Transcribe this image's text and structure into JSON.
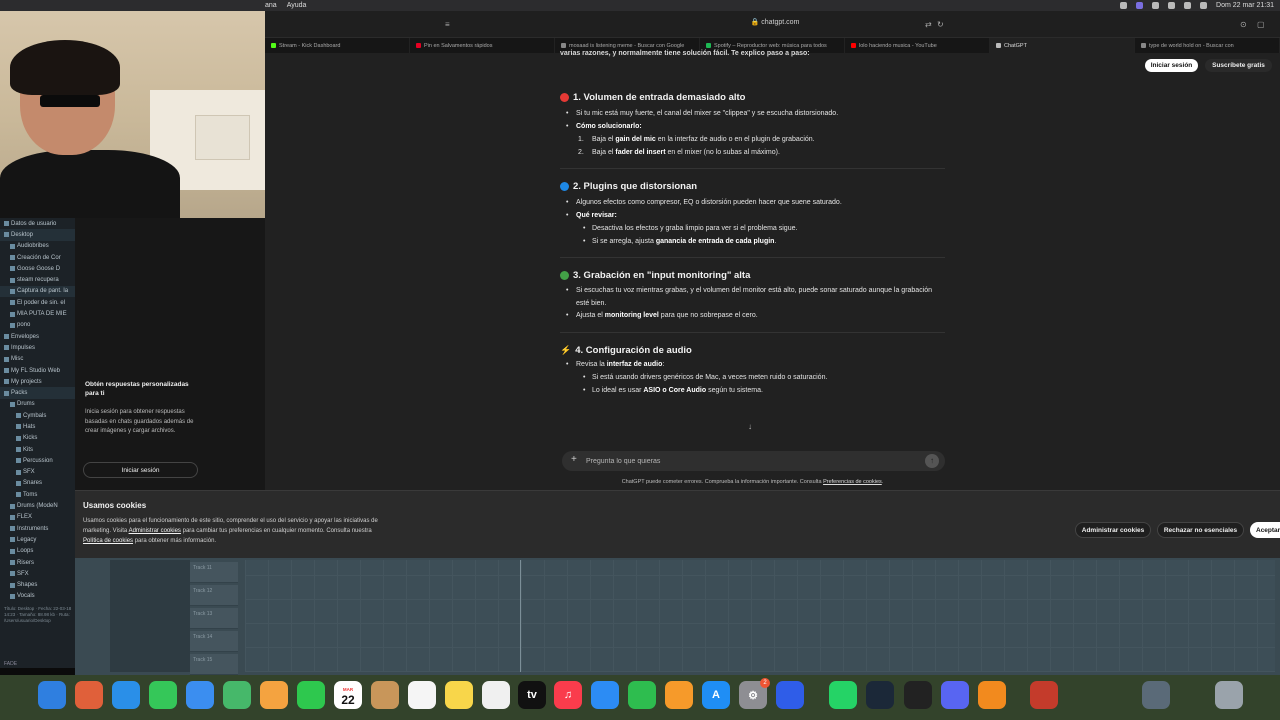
{
  "menubar": {
    "left_items": [
      "ana",
      "Ayuda"
    ],
    "clock": "Dom 22 mar  21:31"
  },
  "browser": {
    "address": "chatgpt.com",
    "tabs": [
      {
        "label": "Stream - Kick Dashboard",
        "color": "#53fc18"
      },
      {
        "label": "Pin en Salvamentos rápidos",
        "color": "#e60023"
      },
      {
        "label": "mosaad is listening meme - Buscar con Google",
        "color": "#888888"
      },
      {
        "label": "Spotify – Reproductor web: música para todos",
        "color": "#1db954"
      },
      {
        "label": "lolo haciendo musica - YouTube",
        "color": "#ff0000"
      },
      {
        "label": "ChatGPT",
        "color": "#bbbbbb",
        "active": true
      },
      {
        "label": "type de world hold on - Buscar con",
        "color": "#888888"
      }
    ]
  },
  "header": {
    "login": "Iniciar sesión",
    "subscribe": "Suscríbete gratis"
  },
  "chat": {
    "intro": "varias razones, y normalmente tiene solución fácil. Te explico paso a paso:",
    "sections": [
      {
        "color": "#e53935",
        "title": "1. Volumen de entrada demasiado alto",
        "b1": "Si tu mic está muy fuerte, el canal del mixer se \"clippea\" y se escucha distorsionado.",
        "b2": "Cómo solucionarlo:",
        "n1_num": "1.",
        "n1_a": "Baja el ",
        "n1_b": "gain del mic",
        "n1_c": " en la interfaz de audio o en el plugin de grabación.",
        "n2_num": "2.",
        "n2_a": "Baja el ",
        "n2_b": "fader del insert",
        "n2_c": " en el mixer (no lo subas al máximo)."
      },
      {
        "color": "#1e88e5",
        "title": "2. Plugins que distorsionan",
        "b1": "Algunos efectos como compresor, EQ o distorsión pueden hacer que suene saturado.",
        "b2": "Qué revisar:",
        "s1": "Desactiva los efectos y graba limpio para ver si el problema sigue.",
        "s2_a": "Si se arregla, ajusta ",
        "s2_b": "ganancia de entrada de cada plugin",
        "s2_c": "."
      },
      {
        "color": "#43a047",
        "title": "3. Grabación en \"input monitoring\" alta",
        "b1": "Si escuchas tu voz mientras grabas, y el volumen del monitor está alto, puede sonar saturado aunque la grabación esté bien.",
        "b2_a": "Ajusta el ",
        "b2_b": "monitoring level",
        "b2_c": " para que no sobrepase el cero."
      },
      {
        "color": "#fdd835",
        "title": "4. Configuración de audio",
        "b1_a": "Revisa la ",
        "b1_b": "interfaz de audio",
        "b1_c": ":",
        "s1": "Si está usando drivers genéricos de Mac, a veces meten ruido o saturación.",
        "s2_a": "Lo ideal es usar ",
        "s2_b": "ASIO o Core Audio",
        "s2_c": " según tu sistema."
      }
    ],
    "scroll_down": "↓",
    "composer_placeholder": "Pregunta lo que quieras",
    "disclaimer": "ChatGPT puede cometer errores. Comprueba la información importante. Consulta",
    "disclaimer_link": "Preferencias de cookies",
    "disclaimer_end": "."
  },
  "sidebar_promo": {
    "title": "Obtén respuestas personalizadas para ti",
    "text": "Inicia sesión para obtener respuestas basadas en chats guardados además de crear imágenes y cargar archivos.",
    "button": "Iniciar sesión"
  },
  "cookies": {
    "title": "Usamos cookies",
    "text_a": "Usamos cookies para el funcionamiento de este sitio, comprender el uso del servicio y apoyar las iniciativas de marketing. Visita ",
    "link1": "Administrar cookies",
    "text_b": " para cambiar tus preferencias en cualquier momento. Consulta nuestra ",
    "link2": "Política de cookies",
    "text_c": " para obtener más información.",
    "admin": "Administrar cookies",
    "reject": "Rechazar no esenciales",
    "accept": "Aceptar"
  },
  "fl_browser": {
    "items": [
      {
        "label": "Datos de usuario",
        "indent": 1
      },
      {
        "label": "Desktop",
        "indent": 1,
        "hl": true
      },
      {
        "label": "Audiobribes",
        "indent": 2
      },
      {
        "label": "Creación de Cor",
        "indent": 2
      },
      {
        "label": "Goose Goose D",
        "indent": 2
      },
      {
        "label": "steam recupera",
        "indent": 2
      },
      {
        "label": "Captura de pant. la",
        "indent": 2,
        "hl": true
      },
      {
        "label": "El poder de sin. el",
        "indent": 2
      },
      {
        "label": "MIA PUTA DE MIE",
        "indent": 2
      },
      {
        "label": "pono",
        "indent": 2
      },
      {
        "label": "Envelopes",
        "indent": 1
      },
      {
        "label": "Impulses",
        "indent": 1
      },
      {
        "label": "Misc",
        "indent": 1
      },
      {
        "label": "My FL Studio Web",
        "indent": 1
      },
      {
        "label": "My projects",
        "indent": 1
      },
      {
        "label": "Packs",
        "indent": 1,
        "hl": true
      },
      {
        "label": "Drums",
        "indent": 2
      },
      {
        "label": "Cymbals",
        "indent": 3
      },
      {
        "label": "Hats",
        "indent": 3
      },
      {
        "label": "Kicks",
        "indent": 3
      },
      {
        "label": "Kits",
        "indent": 3
      },
      {
        "label": "Percussion",
        "indent": 3
      },
      {
        "label": "SFX",
        "indent": 3
      },
      {
        "label": "Snares",
        "indent": 3
      },
      {
        "label": "Toms",
        "indent": 3
      },
      {
        "label": "Drums (ModeN",
        "indent": 2
      },
      {
        "label": "FLEX",
        "indent": 2
      },
      {
        "label": "Instruments",
        "indent": 2
      },
      {
        "label": "Legacy",
        "indent": 2
      },
      {
        "label": "Loops",
        "indent": 2
      },
      {
        "label": "Risers",
        "indent": 2
      },
      {
        "label": "SFX",
        "indent": 2
      },
      {
        "label": "Shapes",
        "indent": 2
      },
      {
        "label": "Vocals",
        "indent": 2
      }
    ],
    "info": "Título: Desktop · Fecha: 22-03-18 14:23 · Tamaño: 88.98 kb · Ruta: /Users/usuario/Desktop",
    "bottom": "FADE"
  },
  "playlist": {
    "tracks": [
      "Track 11",
      "Track 12",
      "Track 13",
      "Track 14",
      "Track 15"
    ]
  },
  "dock": {
    "calendar_month": "MAR",
    "calendar_day": "22",
    "tv_label": "tv",
    "badge": "2",
    "apps": [
      {
        "name": "finder",
        "color": "#2f7fe0",
        "glyph": ""
      },
      {
        "name": "launchpad",
        "color": "#e0603a",
        "glyph": ""
      },
      {
        "name": "safari",
        "color": "#2a8fe8",
        "glyph": ""
      },
      {
        "name": "messages",
        "color": "#35c759",
        "glyph": ""
      },
      {
        "name": "mail",
        "color": "#3b8ef0",
        "glyph": ""
      },
      {
        "name": "maps",
        "color": "#46b86a",
        "glyph": ""
      },
      {
        "name": "photos",
        "color": "#f4a340",
        "glyph": ""
      },
      {
        "name": "facetime",
        "color": "#2ec84e",
        "glyph": ""
      },
      {
        "name": "calendar",
        "color": "#ffffff",
        "glyph": ""
      },
      {
        "name": "contacts",
        "color": "#c8965a",
        "glyph": ""
      },
      {
        "name": "reminders",
        "color": "#f5f5f5",
        "glyph": ""
      },
      {
        "name": "notes",
        "color": "#f8d64a",
        "glyph": ""
      },
      {
        "name": "freeform",
        "color": "#f0f0f0",
        "glyph": ""
      },
      {
        "name": "apple-tv",
        "color": "#111111",
        "glyph": ""
      },
      {
        "name": "music",
        "color": "#fa3c4c",
        "glyph": "♫"
      },
      {
        "name": "keynote",
        "color": "#2c8cf4",
        "glyph": ""
      },
      {
        "name": "numbers",
        "color": "#2ebd4f",
        "glyph": ""
      },
      {
        "name": "pages",
        "color": "#f69a2a",
        "glyph": ""
      },
      {
        "name": "app-store",
        "color": "#1f8ef5",
        "glyph": "A"
      },
      {
        "name": "system-settings",
        "color": "#8e8e93",
        "glyph": "⚙"
      },
      {
        "name": "teleprompter",
        "color": "#2f5de8",
        "glyph": ""
      },
      {
        "name": "whatsapp",
        "color": "#25d366",
        "glyph": ""
      },
      {
        "name": "steam",
        "color": "#1b2838",
        "glyph": ""
      },
      {
        "name": "obs",
        "color": "#222222",
        "glyph": ""
      },
      {
        "name": "discord",
        "color": "#5865f2",
        "glyph": ""
      },
      {
        "name": "fl-studio",
        "color": "#f28a1e",
        "glyph": ""
      },
      {
        "name": "photo-booth",
        "color": "#c43b2b",
        "glyph": ""
      },
      {
        "name": "downloads",
        "color": "#5a6a78",
        "glyph": ""
      },
      {
        "name": "trash",
        "color": "#9aa3ab",
        "glyph": ""
      }
    ]
  }
}
